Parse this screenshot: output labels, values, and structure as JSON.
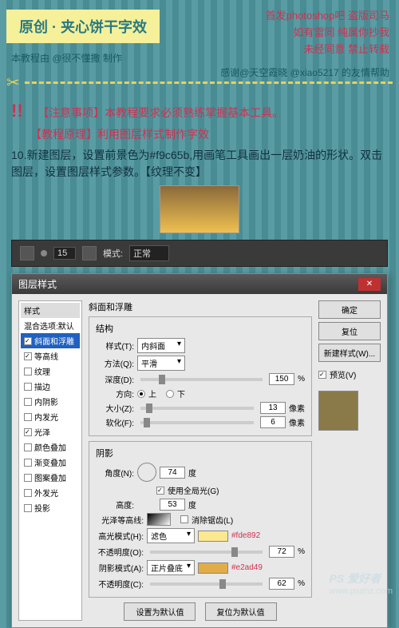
{
  "header": {
    "title": "原创 · 夹心饼干字效",
    "red_lines": [
      "首发photoshop吧 盗版司马",
      "如有雷同 纯属你抄我",
      "未经同意 禁止转载"
    ],
    "credit_left": "本教程由 @很不懂撒 制作",
    "credit_right": "感谢@天空霞晓 @xiao5217 的友情帮助"
  },
  "notes": {
    "n1": "【注意事项】本教程要求必须熟练掌握基本工具。",
    "n2": "【教程原理】利用图层样式制作字效"
  },
  "step": {
    "text": "10.新建图层，设置前景色为#f9c65b,用画笔工具画出一层奶油的形状。双击图层，设置图层样式参数。【纹理不变】"
  },
  "toolbar": {
    "size": "15",
    "mode_label": "模式:",
    "mode_value": "正常"
  },
  "dialog": {
    "title": "图层样式",
    "styles_header": "样式",
    "blend_header": "混合选项:默认",
    "items": {
      "bevel": "斜面和浮雕",
      "contour": "等高线",
      "texture": "纹理",
      "stroke": "描边",
      "inner_shadow": "内阴影",
      "inner_glow": "内发光",
      "satin": "光泽",
      "color_overlay": "颜色叠加",
      "gradient_overlay": "渐变叠加",
      "pattern_overlay": "图案叠加",
      "outer_glow": "外发光",
      "drop_shadow": "投影"
    },
    "panel_title": "斜面和浮雕",
    "structure": "结构",
    "style_label": "样式(T):",
    "style_value": "内斜面",
    "method_label": "方法(Q):",
    "method_value": "平滑",
    "depth_label": "深度(D):",
    "depth_value": "150",
    "pct": "%",
    "dir_label": "方向:",
    "dir_up": "上",
    "dir_down": "下",
    "size_label": "大小(Z):",
    "size_value": "13",
    "px": "像素",
    "soften_label": "软化(F):",
    "soften_value": "6",
    "shading": "阴影",
    "angle_label": "角度(N):",
    "angle_value": "74",
    "deg": "度",
    "global_light": "使用全局光(G)",
    "altitude_label": "高度:",
    "altitude_value": "53",
    "gloss_contour": "光泽等高线:",
    "antialias": "消除锯齿(L)",
    "highlight_mode": "高光模式(H):",
    "highlight_value": "滤色",
    "highlight_hex": "#fde892",
    "highlight_opacity_label": "不透明度(O):",
    "highlight_opacity": "72",
    "shadow_mode": "阴影模式(A):",
    "shadow_value": "正片叠底",
    "shadow_hex": "#e2ad49",
    "shadow_opacity_label": "不透明度(C):",
    "shadow_opacity": "62",
    "set_default": "设置为默认值",
    "reset_default": "复位为默认值",
    "buttons": {
      "ok": "确定",
      "cancel": "复位",
      "new_style": "新建样式(W)...",
      "preview": "预览(V)"
    }
  },
  "watermark": {
    "brand": "PS 爱好者",
    "url": "www.psahz.com"
  }
}
